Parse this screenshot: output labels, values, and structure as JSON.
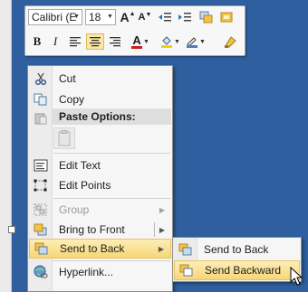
{
  "toolbar": {
    "font_name": "Calibri (E",
    "font_size": "18",
    "grow_font": "A",
    "shrink_font": "A",
    "bold": "B",
    "italic": "I",
    "font_color_letter": "A",
    "font_color_swatch": "#d11a1a",
    "fill_color_swatch": "#f3d200",
    "line_color_swatch": "#4a7fc1"
  },
  "menu": {
    "cut": "Cut",
    "copy": "Copy",
    "paste_options": "Paste Options:",
    "edit_text": "Edit Text",
    "edit_points": "Edit Points",
    "group": "Group",
    "bring_to_front": "Bring to Front",
    "send_to_back": "Send to Back",
    "hyperlink": "Hyperlink..."
  },
  "submenu": {
    "send_to_back": "Send to Back",
    "send_backward": "Send Backward"
  }
}
